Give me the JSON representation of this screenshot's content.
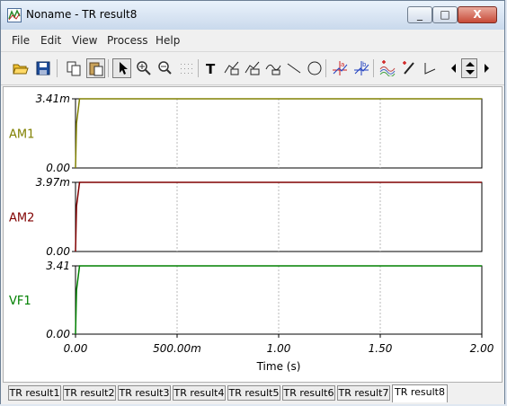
{
  "window": {
    "title": "Noname - TR result8",
    "minimize": "_",
    "maximize": "□",
    "close": "X"
  },
  "menu": [
    "File",
    "Edit",
    "View",
    "Process",
    "Help"
  ],
  "toolbar_icons": [
    "open-folder-icon",
    "save-icon",
    "copy-icon",
    "paste-icon",
    "pointer-icon",
    "zoom-in-icon",
    "zoom-100-icon",
    "grid-icon",
    "text-icon",
    "curve-label-1-icon",
    "curve-label-2-icon",
    "curve-label-3-icon",
    "line-icon",
    "circle-icon",
    "cursor-a-icon",
    "cursor-b-icon",
    "add-cursor-icon",
    "marker-icon",
    "angle-icon",
    "scroll-left-icon",
    "scroll-updown-icon",
    "scroll-right-icon"
  ],
  "chart_data": {
    "type": "line",
    "xlabel": "Time (s)",
    "x_ticks": [
      "0.00",
      "500.00m",
      "1.00",
      "1.50",
      "2.00"
    ],
    "xlim": [
      0,
      2
    ],
    "grid": true,
    "panels": [
      {
        "name": "AM1",
        "color": "#808000",
        "y_top_label": "3.41m",
        "y_bottom_label": "0.00",
        "ylim": [
          0,
          0.00341
        ],
        "x": [
          0,
          0.005,
          0.02,
          2.0
        ],
        "y": [
          0,
          0.0022,
          0.00341,
          0.00341
        ]
      },
      {
        "name": "AM2",
        "color": "#800000",
        "y_top_label": "3.97m",
        "y_bottom_label": "0.00",
        "ylim": [
          0,
          0.00397
        ],
        "x": [
          0,
          0.005,
          0.02,
          2.0
        ],
        "y": [
          0,
          0.0026,
          0.00397,
          0.00397
        ]
      },
      {
        "name": "VF1",
        "color": "#008000",
        "y_top_label": "3.41",
        "y_bottom_label": "0.00",
        "ylim": [
          0,
          3.41
        ],
        "x": [
          0,
          0.005,
          0.02,
          2.0
        ],
        "y": [
          0,
          2.2,
          3.41,
          3.41
        ]
      }
    ]
  },
  "tabs": [
    "TR result1",
    "TR result2",
    "TR result3",
    "TR result4",
    "TR result5",
    "TR result6",
    "TR result7",
    "TR result8"
  ],
  "active_tab": "TR result8"
}
